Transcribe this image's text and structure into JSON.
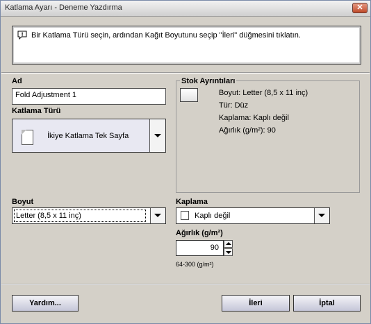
{
  "window": {
    "title": "Katlama Ayarı - Deneme Yazdırma",
    "close_label": "✕"
  },
  "message": {
    "text": "Bir Katlama Türü seçin, ardından Kağıt Boyutunu seçip \"İleri\" düğmesini tıklatın."
  },
  "name": {
    "label": "Ad",
    "value": "Fold Adjustment 1"
  },
  "fold_type": {
    "label": "Katlama Türü",
    "value": "İkiye Katlama Tek Sayfa"
  },
  "stock_details": {
    "legend": "Stok Ayrıntıları",
    "size": "Boyut: Letter (8,5 x 11 inç)",
    "type": "Tür: Düz",
    "coating": "Kaplama: Kaplı değil",
    "weight": "Ağırlık (g/m²): 90"
  },
  "size": {
    "label": "Boyut",
    "value": "Letter (8,5 x 11 inç)"
  },
  "coating": {
    "label": "Kaplama",
    "value": "Kaplı değil"
  },
  "weight": {
    "label": "Ağırlık (g/m²)",
    "value": "90",
    "range": "64-300 (g/m²)"
  },
  "buttons": {
    "help": "Yardım...",
    "next": "İleri",
    "cancel": "İptal"
  },
  "icons": {
    "message": "speech-bubble-exclamation-icon",
    "close": "close-icon",
    "dropdown": "chevron-down-icon"
  }
}
